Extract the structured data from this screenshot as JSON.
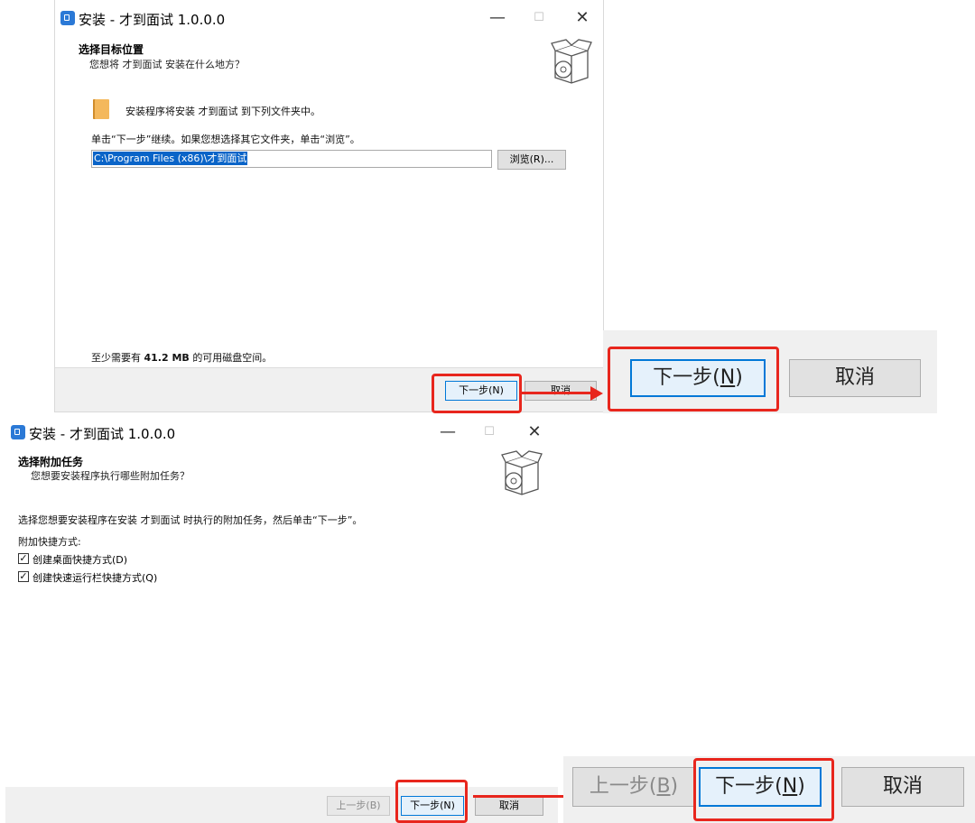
{
  "window1": {
    "title": "安装 - 才到面试 1.0.0.0",
    "controls": {
      "minimize": "—",
      "maximize": "☐",
      "close": "✕"
    },
    "heading": "选择目标位置",
    "subheading": "您想将 才到面试 安装在什么地方？",
    "info_text": "安装程序将安装 才到面试 到下列文件夹中。",
    "instruction": "单击“下一步”继续。如果您想选择其它文件夹，单击“浏览”。",
    "path_value": "C:\\Program Files (x86)\\才到面试",
    "browse_button": "浏览(R)...",
    "disk_space_prefix": "至少需要有",
    "disk_space_value": "41.2 MB",
    "disk_space_suffix": "的可用磁盘空间。",
    "next_button": "下一步(N)",
    "cancel_button": "取消"
  },
  "zoom1": {
    "next_button_prefix": "下一步(",
    "next_button_key": "N",
    "next_button_suffix": ")",
    "cancel_button": "取消"
  },
  "window2": {
    "title": "安装 - 才到面试 1.0.0.0",
    "controls": {
      "minimize": "—",
      "maximize": "☐",
      "close": "✕"
    },
    "heading": "选择附加任务",
    "subheading": "您想要安装程序执行哪些附加任务？",
    "instruction": "选择您想要安装程序在安装 才到面试 时执行的附加任务，然后单击“下一步”。",
    "group_label": "附加快捷方式:",
    "checkbox1_label": "创建桌面快捷方式(D)",
    "checkbox2_label": "创建快速运行栏快捷方式(Q)",
    "back_button": "上一步(B)",
    "next_button": "下一步(N)",
    "cancel_button": "取消"
  },
  "zoom2": {
    "back_button_prefix": "上一步(",
    "back_button_key": "B",
    "back_button_suffix": ")",
    "next_button_prefix": "下一步(",
    "next_button_key": "N",
    "next_button_suffix": ")",
    "cancel_button": "取消"
  },
  "colors": {
    "highlight_red": "#e8261d",
    "accent_blue": "#0078d7",
    "selection_blue": "#0a64c8",
    "footer_gray": "#f0f0f0"
  },
  "icons": [
    "app-icon",
    "software-box-icon",
    "folder-icon",
    "checkbox-checked-icon",
    "arrow-icon"
  ]
}
